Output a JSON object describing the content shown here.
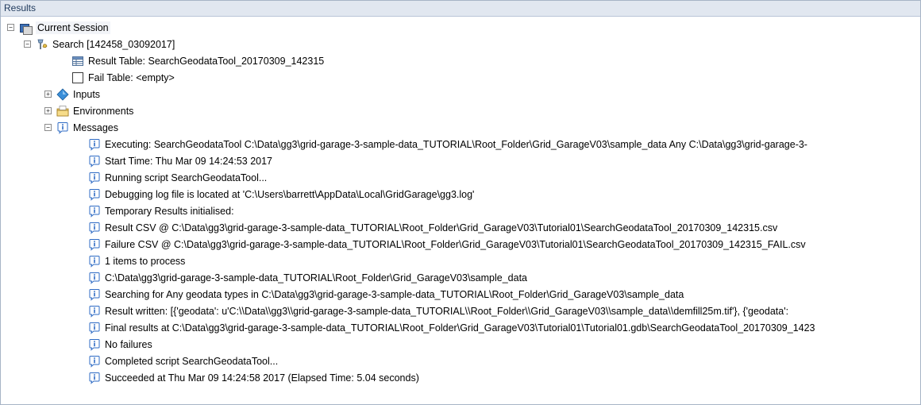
{
  "window": {
    "title": "Results"
  },
  "tree": {
    "session": {
      "label": "Current Session",
      "expander": "−"
    },
    "search": {
      "label": "Search [142458_03092017]",
      "expander": "−"
    },
    "result_table": {
      "label": "Result Table: SearchGeodataTool_20170309_142315"
    },
    "fail_table": {
      "label": "Fail Table: <empty>"
    },
    "inputs": {
      "label": "Inputs",
      "expander": "+"
    },
    "environments": {
      "label": "Environments",
      "expander": "+"
    },
    "messages": {
      "label": "Messages",
      "expander": "−"
    },
    "message_lines": [
      "Executing: SearchGeodataTool C:\\Data\\gg3\\grid-garage-3-sample-data_TUTORIAL\\Root_Folder\\Grid_GarageV03\\sample_data Any C:\\Data\\gg3\\grid-garage-3-",
      "Start Time: Thu Mar 09 14:24:53 2017",
      "Running script SearchGeodataTool...",
      "Debugging log file is located at 'C:\\Users\\barrett\\AppData\\Local\\GridGarage\\gg3.log'",
      "Temporary Results initialised:",
      "Result CSV @ C:\\Data\\gg3\\grid-garage-3-sample-data_TUTORIAL\\Root_Folder\\Grid_GarageV03\\Tutorial01\\SearchGeodataTool_20170309_142315.csv",
      "Failure CSV @ C:\\Data\\gg3\\grid-garage-3-sample-data_TUTORIAL\\Root_Folder\\Grid_GarageV03\\Tutorial01\\SearchGeodataTool_20170309_142315_FAIL.csv",
      "1 items to process",
      "C:\\Data\\gg3\\grid-garage-3-sample-data_TUTORIAL\\Root_Folder\\Grid_GarageV03\\sample_data",
      "Searching for Any geodata types in C:\\Data\\gg3\\grid-garage-3-sample-data_TUTORIAL\\Root_Folder\\Grid_GarageV03\\sample_data",
      "Result written: [{'geodata': u'C:\\\\Data\\\\gg3\\\\grid-garage-3-sample-data_TUTORIAL\\\\Root_Folder\\\\Grid_GarageV03\\\\sample_data\\\\demfill25m.tif'}, {'geodata':",
      "Final results at C:\\Data\\gg3\\grid-garage-3-sample-data_TUTORIAL\\Root_Folder\\Grid_GarageV03\\Tutorial01\\Tutorial01.gdb\\SearchGeodataTool_20170309_1423",
      "No failures",
      "Completed script SearchGeodataTool...",
      "Succeeded at Thu Mar 09 14:24:58 2017 (Elapsed Time: 5.04 seconds)"
    ]
  },
  "icons": {
    "session": "session-icon",
    "search": "tool-icon",
    "result_table": "table-icon",
    "fail_table": "empty-table-icon",
    "inputs": "diamond-icon",
    "environments": "folder-icon",
    "messages": "info-icon"
  },
  "colors": {
    "info_icon": "#2e6bc4",
    "title_bar": "#e1e7f0",
    "title_text": "#1e395b"
  }
}
